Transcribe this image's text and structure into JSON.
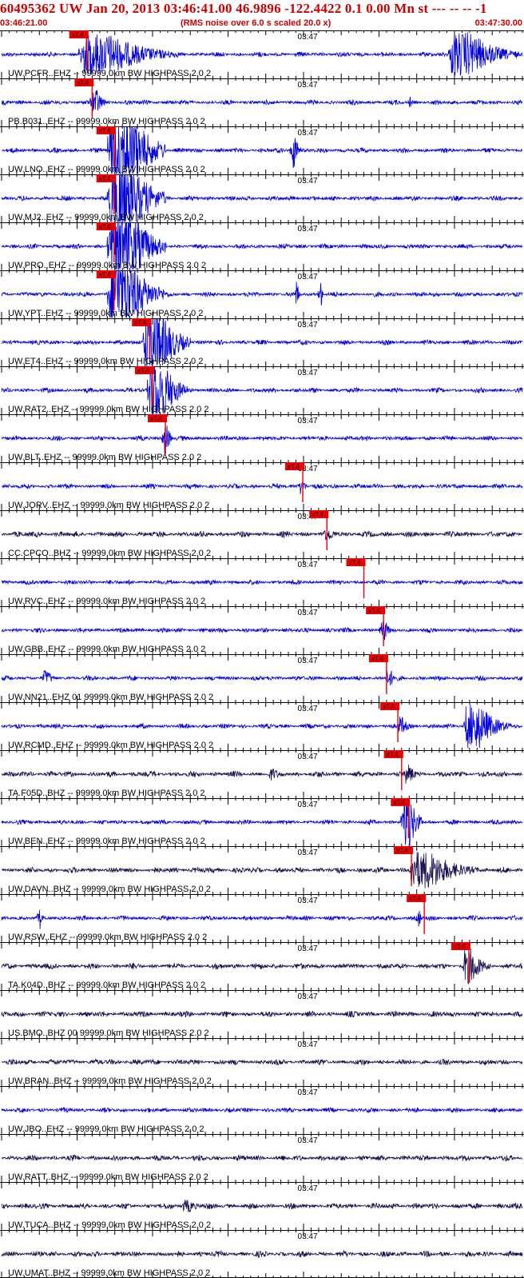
{
  "header": {
    "title": "60495362 UW Jan 20, 2013 03:46:41.00   46.9896 -122.4422  0.1 0.00 Mn st --- -- --  -1",
    "start_time": "03:46:21.00",
    "noise_note": "(RMS noise over 6.0 s scaled 20.0 x)",
    "end_time": "03:47:30.00"
  },
  "colors": {
    "title": "#cc0000",
    "trace_ehz": "#0000dd",
    "trace_bhz": "#1a1050",
    "pick": "#ee0000",
    "grid": "#000000"
  },
  "chart_data": {
    "type": "line",
    "title": "60495362 UW Jan 20, 2013 03:46:41.00   46.9896 -122.4422  0.1 0.00 Mn st --- -- --  -1",
    "x_unit": "seconds after 03:46:21.00",
    "xlim": [
      0,
      69
    ],
    "center_tick_label": "03:47",
    "center_tick_time": 39,
    "pick_label": "xT.4",
    "traces": [
      {
        "label": "UW.PCFR..EHZ -- 99999.0km BW  HIGHPASS  2.0  2",
        "kind": "EHZ",
        "pick_s": 11.3,
        "bursts": [
          {
            "t": 10.5,
            "amp": 26,
            "dur": 13
          },
          {
            "t": 59.5,
            "amp": 28,
            "dur": 9
          }
        ]
      },
      {
        "label": "PB.B031..EHZ -- 99999.0km BW  HIGHPASS  2.0  2",
        "kind": "EHZ",
        "pick_s": 12.0,
        "bursts": [
          {
            "t": 12.0,
            "amp": 18,
            "dur": 2
          },
          {
            "t": 54,
            "amp": 10,
            "dur": 0.4
          }
        ]
      },
      {
        "label": "UW.LNO..EHZ -- 99999.0km BW  HIGHPASS  2.0  2",
        "kind": "EHZ",
        "pick_s": 14.9,
        "bursts": [
          {
            "t": 14.3,
            "amp": 60,
            "dur": 7.5
          },
          {
            "t": 38.5,
            "amp": 24,
            "dur": 1.2
          }
        ]
      },
      {
        "label": "UW.MJ2..EHZ -- 99999.0km BW  HIGHPASS  2.0  2",
        "kind": "EHZ",
        "pick_s": 14.9,
        "bursts": [
          {
            "t": 14.3,
            "amp": 55,
            "dur": 7.5
          }
        ]
      },
      {
        "label": "UW.PRO..EHZ -- 99999.0km BW  HIGHPASS  2.0  2",
        "kind": "EHZ",
        "pick_s": 14.9,
        "bursts": [
          {
            "t": 14.3,
            "amp": 55,
            "dur": 7.5
          }
        ]
      },
      {
        "label": "UW.YPT..EHZ -- 99999.0km BW  HIGHPASS  2.0  2",
        "kind": "EHZ",
        "pick_s": 14.9,
        "bursts": [
          {
            "t": 14.3,
            "amp": 52,
            "dur": 7.3
          },
          {
            "t": 39.0,
            "amp": 18,
            "dur": 0.6
          },
          {
            "t": 42.2,
            "amp": 22,
            "dur": 0.4
          }
        ]
      },
      {
        "label": "UW.ET4..EHZ -- 99999.0km BW  HIGHPASS  2.0  2",
        "kind": "EHZ",
        "pick_s": 19.6,
        "bursts": [
          {
            "t": 19.0,
            "amp": 45,
            "dur": 6.0
          }
        ]
      },
      {
        "label": "UW.RAT2..EHZ -- 99999.0km BW  HIGHPASS  2.0  2",
        "kind": "EHZ",
        "pick_s": 20.0,
        "bursts": [
          {
            "t": 19.6,
            "amp": 45,
            "dur": 5.0
          }
        ]
      },
      {
        "label": "UW.BLT..EHZ -- 99999.0km BW  HIGHPASS  2.0  2",
        "kind": "EHZ",
        "pick_s": 21.7,
        "bursts": [
          {
            "t": 21.5,
            "amp": 22,
            "dur": 1.2
          }
        ]
      },
      {
        "label": "UW.JORV..EHZ -- 99999.0km BW  HIGHPASS  2.0  2",
        "kind": "EHZ",
        "pick_s": 39.9,
        "bursts": [
          {
            "t": 39.5,
            "amp": 10,
            "dur": 1.2
          }
        ]
      },
      {
        "label": "CC.CPCO..BHZ -- 99999.0km BW  HIGHPASS  2.0  2",
        "kind": "BHZ",
        "pick_s": 43.1,
        "bursts": [
          {
            "t": 42.5,
            "amp": 8,
            "dur": 3.0
          }
        ]
      },
      {
        "label": "UW.RVC..EHZ -- 99999.0km BW  HIGHPASS  2.0  2",
        "kind": "EHZ",
        "pick_s": 48.0,
        "bursts": []
      },
      {
        "label": "UW.GBB..EHZ -- 99999.0km BW  HIGHPASS  2.0  2",
        "kind": "EHZ",
        "pick_s": 50.6,
        "bursts": [
          {
            "t": 50.3,
            "amp": 14,
            "dur": 1.5
          }
        ]
      },
      {
        "label": "UW.NN21..EHZ 01 99999.0km BW  HIGHPASS  2.0  2",
        "kind": "EHZ",
        "pick_s": 51.0,
        "bursts": [
          {
            "t": 5.5,
            "amp": 10,
            "dur": 2.0
          },
          {
            "t": 51,
            "amp": 10,
            "dur": 2.0
          }
        ]
      },
      {
        "label": "UW.RCMD..EHZ -- 99999.0km BW  HIGHPASS  2.0  2",
        "kind": "EHZ",
        "pick_s": 52.5,
        "bursts": [
          {
            "t": 52.5,
            "amp": 12,
            "dur": 2.0
          },
          {
            "t": 61.5,
            "amp": 28,
            "dur": 6.0
          }
        ]
      },
      {
        "label": "TA.F05D..BHZ -- 99999.0km BW  HIGHPASS  2.0  2",
        "kind": "BHZ",
        "pick_s": 53.0,
        "bursts": [
          {
            "t": 35.5,
            "amp": 8,
            "dur": 2.0
          },
          {
            "t": 53.5,
            "amp": 12,
            "dur": 2.0
          }
        ]
      },
      {
        "label": "UW.BEN..EHZ -- 99999.0km BW  HIGHPASS  2.0  2",
        "kind": "EHZ",
        "pick_s": 53.9,
        "bursts": [
          {
            "t": 53.2,
            "amp": 40,
            "dur": 2.6
          }
        ]
      },
      {
        "label": "UW.DAVN..BHZ -- 99999.0km BW  HIGHPASS  2.0  2",
        "kind": "BHZ",
        "pick_s": 54.3,
        "bursts": [
          {
            "t": 54.2,
            "amp": 24,
            "dur": 9.0
          }
        ]
      },
      {
        "label": "UW.RSW..EHZ -- 99999.0km BW  HIGHPASS  2.0  2",
        "kind": "EHZ",
        "pick_s": 56.0,
        "bursts": [
          {
            "t": 5.0,
            "amp": 18,
            "dur": 0.3
          },
          {
            "t": 55.2,
            "amp": 14,
            "dur": 0.5
          }
        ]
      },
      {
        "label": "TA.K04D..BHZ -- 99999.0km BW  HIGHPASS  2.0  2",
        "kind": "BHZ",
        "pick_s": 61.9,
        "bursts": [
          {
            "t": 61.3,
            "amp": 22,
            "dur": 3.5
          }
        ]
      },
      {
        "label": "US.BMO..BHZ 00 99999.0km BW  HIGHPASS  2.0  2",
        "kind": "BHZ",
        "pick_s": null,
        "bursts": []
      },
      {
        "label": "UW.BRAN..BHZ -- 99999.0km BW  HIGHPASS  2.0  2",
        "kind": "BHZ",
        "pick_s": null,
        "bursts": []
      },
      {
        "label": "UW.JBO..EHZ -- 99999.0km BW  HIGHPASS  2.0  2",
        "kind": "EHZ",
        "pick_s": null,
        "bursts": []
      },
      {
        "label": "UW.RATT..BHZ -- 99999.0km BW  HIGHPASS  2.0  2",
        "kind": "BHZ",
        "pick_s": null,
        "bursts": []
      },
      {
        "label": "UW.TUCA..BHZ -- 99999.0km BW  HIGHPASS  2.0  2",
        "kind": "BHZ",
        "pick_s": null,
        "bursts": [
          {
            "t": 24,
            "amp": 8,
            "dur": 3.0
          }
        ]
      },
      {
        "label": "UW.UMAT..BHZ -- 99999.0km BW  HIGHPASS  2.0  2",
        "kind": "BHZ",
        "pick_s": null,
        "bursts": []
      }
    ]
  }
}
